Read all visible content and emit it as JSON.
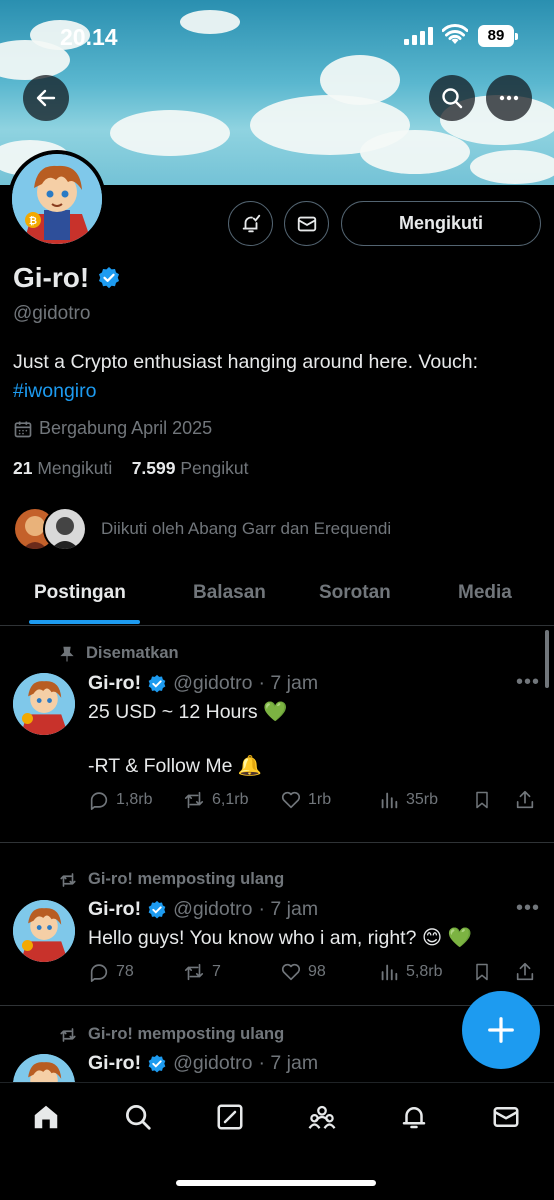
{
  "status_bar": {
    "time": "20.14",
    "battery": "89"
  },
  "profile": {
    "display_name": "Gi-ro!",
    "handle": "@gidotro",
    "bio_text": "Just a Crypto enthusiast hanging around here. Vouch: ",
    "bio_hashtag": "#iwongiro",
    "joined": "Bergabung April 2025",
    "following_count": "21",
    "following_label": "Mengikuti",
    "followers_count": "7.599",
    "followers_label": "Pengikut",
    "followed_by": "Diikuti oleh Abang Garr dan Erequendi",
    "follow_button_label": "Mengikuti"
  },
  "tabs": [
    {
      "label": "Postingan",
      "active": true
    },
    {
      "label": "Balasan",
      "active": false
    },
    {
      "label": "Sorotan",
      "active": false
    },
    {
      "label": "Media",
      "active": false
    }
  ],
  "posts": [
    {
      "meta": "Disematkan",
      "meta_icon": "pin-icon",
      "name": "Gi-ro!",
      "handle": "@gidotro",
      "time": "· 7 jam",
      "text": "25 USD ~ 12 Hours 💚\n\n-RT & Follow Me 🔔",
      "replies": "1,8rb",
      "reposts": "6,1rb",
      "likes": "1rb",
      "views": "35rb"
    },
    {
      "meta": "Gi-ro! memposting ulang",
      "meta_icon": "repost-icon",
      "name": "Gi-ro!",
      "handle": "@gidotro",
      "time": "· 7 jam",
      "text": "Hello guys! You know who i am, right? 😊 💚",
      "replies": "78",
      "reposts": "7",
      "likes": "98",
      "views": "5,8rb"
    },
    {
      "meta": "Gi-ro! memposting ulang",
      "meta_icon": "repost-icon",
      "name": "Gi-ro!",
      "handle": "@gidotro",
      "time": "· 7 jam"
    }
  ],
  "colors": {
    "accent": "#1d9bf0",
    "muted": "#71767b",
    "background": "#000000",
    "verified": "#1d9bf0"
  },
  "nav_icons": [
    "home-icon",
    "search-icon",
    "grok-icon",
    "communities-icon",
    "notifications-icon",
    "messages-icon"
  ]
}
